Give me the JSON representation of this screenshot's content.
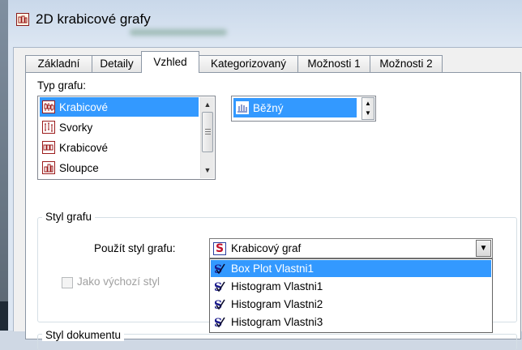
{
  "window": {
    "title": "2D krabicové grafy"
  },
  "tabs": [
    {
      "label": "Základní",
      "active": false
    },
    {
      "label": "Detaily",
      "active": false
    },
    {
      "label": "Vzhled",
      "active": true
    },
    {
      "label": "Kategorizovaný",
      "active": false
    },
    {
      "label": "Možnosti 1",
      "active": false
    },
    {
      "label": "Možnosti 2",
      "active": false
    }
  ],
  "chart_type": {
    "label": "Typ grafu:",
    "items": [
      {
        "label": "Krabicové",
        "icon": "box-whisker-icon",
        "selected": true
      },
      {
        "label": "Svorky",
        "icon": "whisker-icon",
        "selected": false
      },
      {
        "label": "Krabicové",
        "icon": "boxes-icon",
        "selected": false
      },
      {
        "label": "Sloupce",
        "icon": "columns-icon",
        "selected": false
      }
    ],
    "subtype": {
      "label": "Běžný",
      "icon": "regular-icon",
      "selected": true
    }
  },
  "chart_style": {
    "group_title": "Styl grafu",
    "use_style_label": "Použít styl grafu:",
    "selected_value": "Krabicový graf",
    "default_checkbox_label": "Jako výchozí styl",
    "default_checkbox_checked": false,
    "options": [
      {
        "label": "Box Plot Vlastni1",
        "selected": true
      },
      {
        "label": "Histogram Vlastni1",
        "selected": false
      },
      {
        "label": "Histogram Vlastni2",
        "selected": false
      },
      {
        "label": "Histogram Vlastni3",
        "selected": false
      }
    ]
  },
  "document_style": {
    "group_title": "Styl dokumentu"
  },
  "colors": {
    "selection": "#3399ff",
    "icon_red": "#9c1c1c"
  }
}
